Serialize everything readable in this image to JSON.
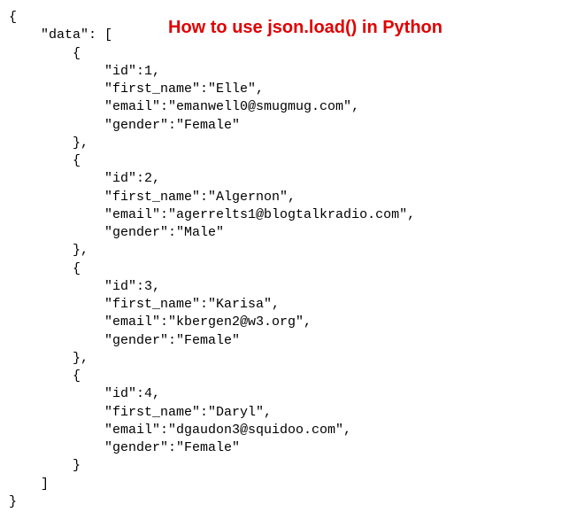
{
  "title": "How to use json.load() in Python",
  "root_key": "data",
  "records": [
    {
      "id": 1,
      "first_name": "Elle",
      "email": "emanwell0@smugmug.com",
      "gender": "Female"
    },
    {
      "id": 2,
      "first_name": "Algernon",
      "email": "agerrelts1@blogtalkradio.com",
      "gender": "Male"
    },
    {
      "id": 3,
      "first_name": "Karisa",
      "email": "kbergen2@w3.org",
      "gender": "Female"
    },
    {
      "id": 4,
      "first_name": "Daryl",
      "email": "dgaudon3@squidoo.com",
      "gender": "Female"
    }
  ],
  "field_order": [
    "id",
    "first_name",
    "email",
    "gender"
  ]
}
